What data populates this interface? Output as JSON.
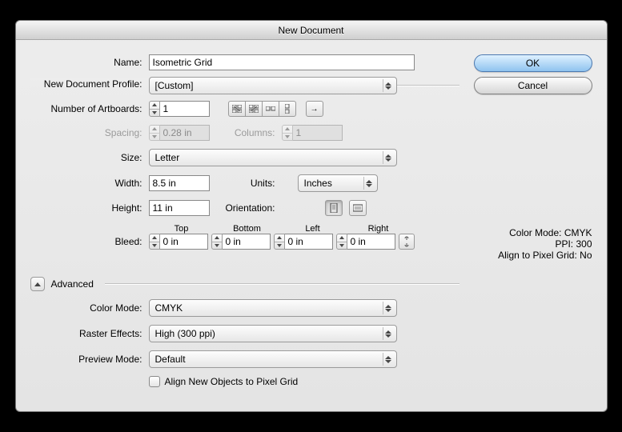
{
  "title": "New Document",
  "buttons": {
    "ok": "OK",
    "cancel": "Cancel"
  },
  "labels": {
    "name": "Name:",
    "profile": "New Document Profile:",
    "artboards": "Number of Artboards:",
    "spacing": "Spacing:",
    "columns": "Columns:",
    "size": "Size:",
    "width": "Width:",
    "units": "Units:",
    "height": "Height:",
    "orientation": "Orientation:",
    "bleed": "Bleed:",
    "top": "Top",
    "bottom": "Bottom",
    "leftb": "Left",
    "rightb": "Right",
    "advanced": "Advanced",
    "colorMode": "Color Mode:",
    "raster": "Raster Effects:",
    "preview": "Preview Mode:",
    "align": "Align New Objects to Pixel Grid"
  },
  "values": {
    "name": "Isometric Grid",
    "profile": "[Custom]",
    "artboards": "1",
    "spacing": "0.28 in",
    "columns": "1",
    "size": "Letter",
    "width": "8.5 in",
    "units": "Inches",
    "height": "11 in",
    "bleedTop": "0 in",
    "bleedBottom": "0 in",
    "bleedLeft": "0 in",
    "bleedRight": "0 in",
    "colorMode": "CMYK",
    "raster": "High (300 ppi)",
    "preview": "Default"
  },
  "summary": {
    "colorMode": "Color Mode: CMYK",
    "ppi": "PPI: 300",
    "align": "Align to Pixel Grid: No"
  }
}
